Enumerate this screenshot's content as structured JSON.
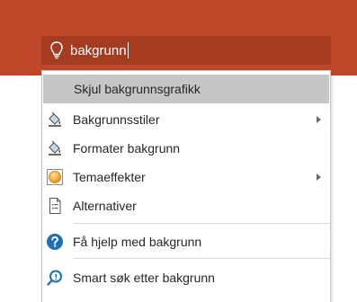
{
  "search": {
    "query": "bakgrunn",
    "icon": "lightbulb-icon"
  },
  "colors": {
    "ribbon": "#c0482a",
    "search_box": "#a53c22",
    "highlight": "#c6c6c6",
    "help_blue": "#1f6fb5"
  },
  "menu": {
    "items": [
      {
        "label": "Skjul bakgrunnsgrafikk",
        "icon": "none",
        "submenu": false,
        "highlighted": true
      },
      {
        "label": "Bakgrunnsstiler",
        "icon": "paint-bucket-icon",
        "submenu": true
      },
      {
        "label": "Formater bakgrunn",
        "icon": "paint-bucket-icon",
        "submenu": false
      },
      {
        "label": "Temaeffekter",
        "icon": "theme-effects-icon",
        "submenu": true
      },
      {
        "label": "Alternativer",
        "icon": "document-icon",
        "submenu": false
      },
      {
        "label": "Få hjelp med bakgrunn",
        "icon": "help-icon",
        "submenu": false
      },
      {
        "label": "Smart søk etter bakgrunn",
        "icon": "smart-lookup-icon",
        "submenu": false
      }
    ]
  }
}
